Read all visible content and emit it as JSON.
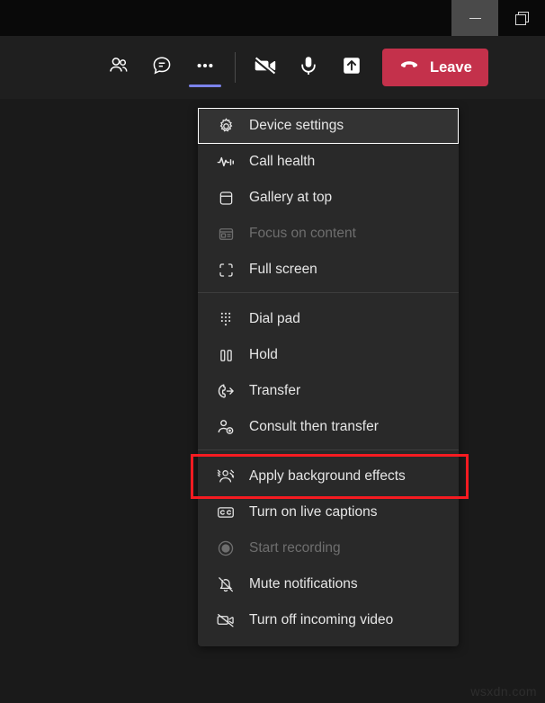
{
  "window_controls": {
    "minimize": {
      "label": "Minimize",
      "icon": "minimize-icon",
      "hovered": true
    },
    "restore": {
      "label": "Restore",
      "icon": "restore-icon",
      "hovered": false
    }
  },
  "toolbar": {
    "items": [
      {
        "name": "people",
        "icon": "people-icon",
        "label": "Show participants",
        "active": false
      },
      {
        "name": "chat",
        "icon": "chat-icon",
        "label": "Show conversation",
        "active": false
      },
      {
        "name": "more",
        "icon": "more-options-icon",
        "label": "More actions",
        "active": true
      }
    ],
    "media": [
      {
        "name": "camera",
        "icon": "camera-off-icon",
        "label": "Turn camera on"
      },
      {
        "name": "microphone",
        "icon": "microphone-icon",
        "label": "Mute"
      },
      {
        "name": "share",
        "icon": "share-tray-icon",
        "label": "Share content"
      }
    ],
    "leave": {
      "label": "Leave",
      "icon": "hangup-icon",
      "color": "#c4314b"
    },
    "accent_color": "#7b83eb"
  },
  "menu": {
    "groups": [
      {
        "items": [
          {
            "label": "Device settings",
            "icon": "gear-icon",
            "disabled": false,
            "focused": true,
            "marked": false
          },
          {
            "label": "Call health",
            "icon": "pulse-icon",
            "disabled": false,
            "focused": false,
            "marked": false
          },
          {
            "label": "Gallery at top",
            "icon": "gallery-top-icon",
            "disabled": false,
            "focused": false,
            "marked": false
          },
          {
            "label": "Focus on content",
            "icon": "focus-content-icon",
            "disabled": true,
            "focused": false,
            "marked": false
          },
          {
            "label": "Full screen",
            "icon": "full-screen-icon",
            "disabled": false,
            "focused": false,
            "marked": false
          }
        ]
      },
      {
        "items": [
          {
            "label": "Dial pad",
            "icon": "dial-pad-icon",
            "disabled": false,
            "focused": false,
            "marked": false
          },
          {
            "label": "Hold",
            "icon": "hold-icon",
            "disabled": false,
            "focused": false,
            "marked": false
          },
          {
            "label": "Transfer",
            "icon": "transfer-icon",
            "disabled": false,
            "focused": false,
            "marked": false
          },
          {
            "label": "Consult then transfer",
            "icon": "consult-transfer-icon",
            "disabled": false,
            "focused": false,
            "marked": false
          }
        ]
      },
      {
        "items": [
          {
            "label": "Apply background effects",
            "icon": "background-effects-icon",
            "disabled": false,
            "focused": false,
            "marked": true
          },
          {
            "label": "Turn on live captions",
            "icon": "closed-captions-icon",
            "disabled": false,
            "focused": false,
            "marked": false
          },
          {
            "label": "Start recording",
            "icon": "record-icon",
            "disabled": true,
            "focused": false,
            "marked": false
          },
          {
            "label": "Mute notifications",
            "icon": "bell-off-icon",
            "disabled": false,
            "focused": false,
            "marked": false
          },
          {
            "label": "Turn off incoming video",
            "icon": "incoming-video-off-icon",
            "disabled": false,
            "focused": false,
            "marked": false
          }
        ]
      }
    ],
    "highlight_color": "#f51b21"
  },
  "watermark": {
    "text": "wsxdn.com"
  }
}
